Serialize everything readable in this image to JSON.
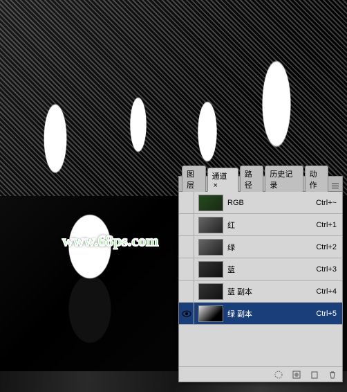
{
  "watermark": "www.68ps.com",
  "panel": {
    "tabs": {
      "layers": "图层",
      "channels": "通道",
      "paths": "路径",
      "history": "历史记录",
      "actions": "动作"
    },
    "channels": [
      {
        "name": "RGB",
        "shortcut": "Ctrl+~",
        "visible": false,
        "thumb": "rgb"
      },
      {
        "name": "红",
        "shortcut": "Ctrl+1",
        "visible": false,
        "thumb": "gray"
      },
      {
        "name": "绿",
        "shortcut": "Ctrl+2",
        "visible": false,
        "thumb": "gray"
      },
      {
        "name": "蓝",
        "shortcut": "Ctrl+3",
        "visible": false,
        "thumb": "dark"
      },
      {
        "name": "蓝 副本",
        "shortcut": "Ctrl+4",
        "visible": false,
        "thumb": "dark"
      },
      {
        "name": "绿 副本",
        "shortcut": "Ctrl+5",
        "visible": true,
        "thumb": "bw",
        "selected": true
      }
    ],
    "footer_icons": {
      "load_selection": "load-selection-icon",
      "save_selection": "save-selection-icon",
      "new_channel": "new-channel-icon",
      "delete_channel": "delete-channel-icon"
    }
  },
  "colors": {
    "selection_bg": "#1a3e7a",
    "panel_bg": "#d6d6d6"
  }
}
